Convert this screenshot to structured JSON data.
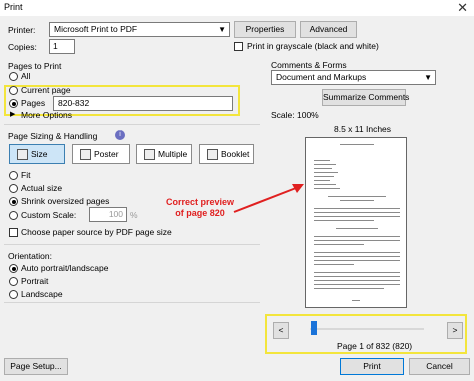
{
  "window": {
    "title": "Print",
    "close_glyph": "✕"
  },
  "printer": {
    "label": "Printer:",
    "value": "Microsoft Print to PDF",
    "properties_label": "Properties",
    "advanced_label": "Advanced"
  },
  "copies": {
    "label": "Copies:",
    "value": "1",
    "grayscale_label": "Print in grayscale (black and white)"
  },
  "pages_to_print": {
    "title": "Pages to Print",
    "all_label": "All",
    "current_label": "Current page",
    "pages_label": "Pages",
    "pages_value": "820-832",
    "more_options_label": "More Options"
  },
  "sizing": {
    "title": "Page Sizing & Handling",
    "info_glyph": "i",
    "tabs": [
      {
        "label": "Size",
        "icon": "size-icon"
      },
      {
        "label": "Poster",
        "icon": "poster-icon"
      },
      {
        "label": "Multiple",
        "icon": "multiple-icon"
      },
      {
        "label": "Booklet",
        "icon": "booklet-icon"
      }
    ],
    "fit_label": "Fit",
    "actual_size_label": "Actual size",
    "shrink_label": "Shrink oversized pages",
    "custom_scale_label": "Custom Scale:",
    "custom_scale_value": "100",
    "custom_scale_unit": "%",
    "choose_paper_label": "Choose paper source by PDF page size"
  },
  "orientation": {
    "title": "Orientation:",
    "auto_label": "Auto portrait/landscape",
    "portrait_label": "Portrait",
    "landscape_label": "Landscape"
  },
  "comments": {
    "title": "Comments & Forms",
    "value": "Document and Markups",
    "summarize_label": "Summarize Comments"
  },
  "preview": {
    "scale_label": "Scale: 100%",
    "paper_size": "8.5 x 11 Inches",
    "annotation_line1": "Correct preview",
    "annotation_line2": "of page 820",
    "page_status": "Page 1 of 832 (820)",
    "prev_glyph": "<",
    "next_glyph": ">",
    "slider_position": 0.01
  },
  "footer": {
    "page_setup_label": "Page Setup...",
    "print_label": "Print",
    "cancel_label": "Cancel"
  }
}
